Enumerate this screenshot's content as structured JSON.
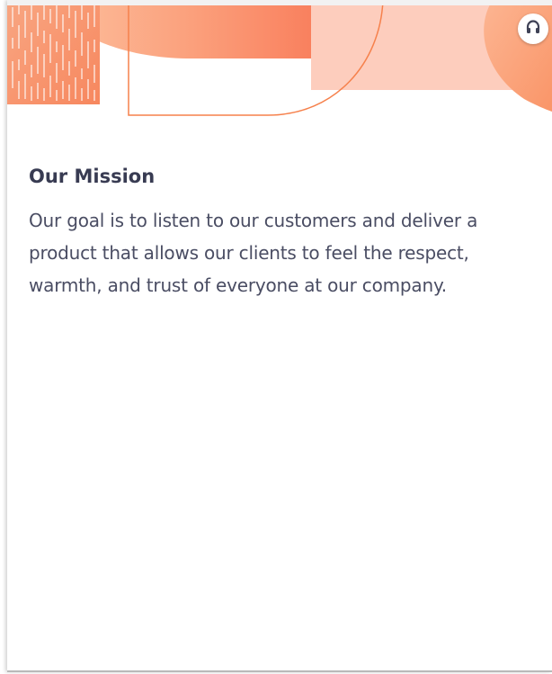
{
  "hero": {
    "decoration": "abstract-orange-shapes"
  },
  "toolbar": {
    "audio_icon": "headphones-icon"
  },
  "mission": {
    "title": "Our Mission",
    "body": "Our goal is to listen to our customers and deliver a product that allows our clients to feel the respect, warmth, and trust of everyone at our company."
  },
  "colors": {
    "accent": "#f58a5e",
    "accent_light": "#fdc9b5",
    "title": "#383b52",
    "text": "#4a4d63"
  }
}
